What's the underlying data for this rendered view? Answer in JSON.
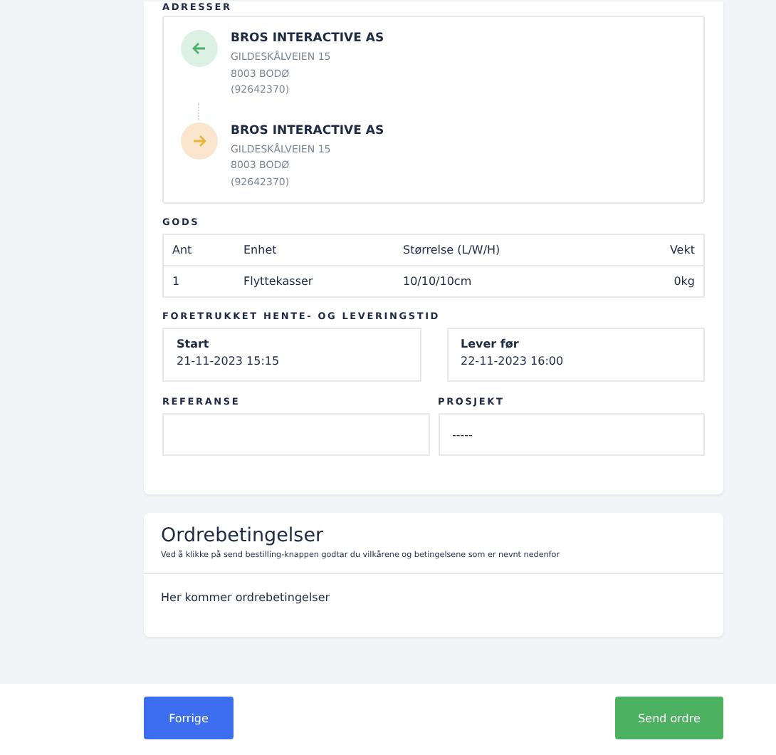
{
  "addresses": {
    "label": "ADRESSER",
    "items": [
      {
        "kind": "from",
        "name": "BROS INTERACTIVE AS",
        "street": "GILDESKÅLVEIEN 15",
        "city": "8003 BODØ",
        "phone": "(92642370)"
      },
      {
        "kind": "to",
        "name": "BROS INTERACTIVE AS",
        "street": "GILDESKÅLVEIEN 15",
        "city": "8003 BODØ",
        "phone": "(92642370)"
      }
    ]
  },
  "goods": {
    "label": "GODS",
    "columns": [
      "Ant",
      "Enhet",
      "Størrelse (L/W/H)",
      "Vekt"
    ],
    "rows": [
      [
        "1",
        "Flyttekasser",
        "10/10/10cm",
        "0kg"
      ]
    ]
  },
  "times": {
    "label": "FORETRUKKET HENTE- OG LEVERINGSTID",
    "items": [
      {
        "title": "Start",
        "value": "21-11-2023 15:15"
      },
      {
        "title": "Lever før",
        "value": "22-11-2023 16:00"
      }
    ]
  },
  "fields": [
    {
      "label": "REFERANSE"
    },
    {
      "label": "PROSJEKT",
      "value": "-----"
    }
  ],
  "terms": {
    "title": "Ordrebetingelser",
    "subtitle": "Ved å klikke på send bestilling-knappen godtar du vilkårene og betingelsene som er nevnt nedenfor",
    "body": "Her kommer ordrebetingelser"
  },
  "buttons": {
    "back": "Forrige",
    "submit": "Send ordre"
  }
}
